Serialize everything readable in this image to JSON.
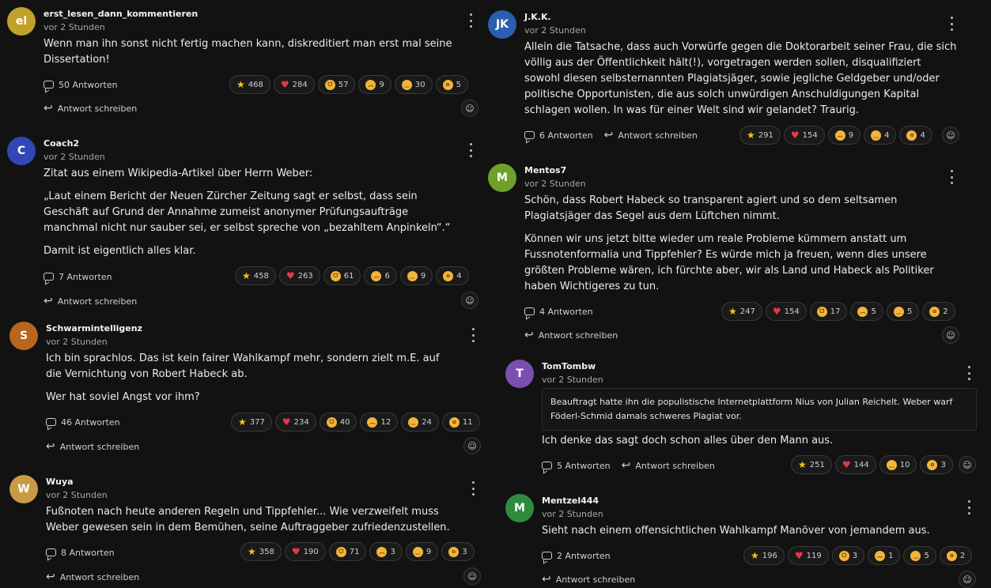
{
  "left": [
    {
      "initials": "el",
      "color": "#c2a12b",
      "author": "erst_lesen_dann_kommentieren",
      "time": "vor 2 Stunden",
      "paragraphs": [
        "Wenn man ihn sonst nicht fertig machen kann, diskreditiert man erst mal seine Dissertation!"
      ],
      "replies": "50 Antworten",
      "reply_label": "Antwort schreiben",
      "reactions": {
        "star": "468",
        "heart": "284",
        "grin": "57",
        "sad": "9",
        "smile": "30",
        "wow": "5"
      }
    },
    {
      "initials": "C",
      "color": "#3346b8",
      "author": "Coach2",
      "time": "vor 2 Stunden",
      "paragraphs": [
        "Zitat aus einem Wikipedia-Artikel über Herrn Weber:",
        "„Laut einem Bericht der Neuen Zürcher Zeitung sagt er selbst, dass sein Geschäft auf Grund der Annahme zumeist anonymer Prüfungsaufträge manchmal nicht nur sauber sei, er selbst spreche von „bezahltem Anpinkeln“.“",
        "Damit ist eigentlich alles klar."
      ],
      "replies": "7 Antworten",
      "reply_label": "Antwort schreiben",
      "reactions": {
        "star": "458",
        "heart": "263",
        "grin": "61",
        "sad": "6",
        "smile": "9",
        "wow": "4"
      }
    },
    {
      "initials": "S",
      "color": "#b8651f",
      "author": "Schwarmintelligenz",
      "time": "vor 2 Stunden",
      "paragraphs": [
        "Ich bin sprachlos. Das ist kein fairer Wahlkampf mehr, sondern zielt m.E. auf die Vernichtung von Robert Habeck ab.",
        "Wer hat soviel Angst vor ihm?"
      ],
      "replies": "46 Antworten",
      "reply_label": "Antwort schreiben",
      "reactions": {
        "star": "377",
        "heart": "234",
        "grin": "40",
        "sad": "12",
        "smile": "24",
        "wow": "11"
      }
    },
    {
      "initials": "W",
      "color": "#c99a45",
      "author": "Wuya",
      "time": "vor 2 Stunden",
      "paragraphs": [
        "Fußnoten nach heute anderen Regeln und Tippfehler... Wie verzweifelt muss Weber gewesen sein in dem Bemühen, seine Auftraggeber zufriedenzustellen."
      ],
      "replies": "8 Antworten",
      "reply_label": "Antwort schreiben",
      "reactions": {
        "star": "358",
        "heart": "190",
        "grin": "71",
        "sad": "3",
        "smile": "9",
        "wow": "3"
      }
    }
  ],
  "right": [
    {
      "initials": "JK",
      "color": "#2a5fb0",
      "author": "J.K.K.",
      "time": "vor 2 Stunden",
      "paragraphs": [
        "Allein die Tatsache, dass auch Vorwürfe gegen die Doktorarbeit seiner Frau, die sich völlig aus der Öffentlichkeit hält(!), vorgetragen werden sollen, disqualifiziert sowohl diesen selbsternannten Plagiatsjäger, sowie jegliche Geldgeber und/oder politische Opportunisten, die aus solch unwürdigen Anschuldigungen Kapital schlagen wollen. In was für einer Welt sind wir gelandet? Traurig."
      ],
      "replies": "6 Antworten",
      "reply_label": "Antwort schreiben",
      "reactions": {
        "star": "291",
        "heart": "154",
        "sad": "9",
        "smile": "4",
        "wow": "4"
      }
    },
    {
      "initials": "M",
      "color": "#6fa12a",
      "author": "Mentos7",
      "time": "vor 2 Stunden",
      "paragraphs": [
        "Schön, dass Robert Habeck so transparent agiert und so dem seltsamen Plagiatsjäger das Segel aus dem Lüftchen nimmt.",
        "Können wir uns jetzt bitte wieder um reale Probleme kümmern anstatt um Fussnotenformalia und Tippfehler? Es würde mich ja freuen, wenn dies unsere größten Probleme wären, ich fürchte aber, wir als Land und Habeck als Politiker haben Wichtigeres zu tun."
      ],
      "replies": "4 Antworten",
      "reply_label": "Antwort schreiben",
      "reactions": {
        "star": "247",
        "heart": "154",
        "grin": "17",
        "sad": "5",
        "smile": "5",
        "wow": "2"
      }
    },
    {
      "initials": "T",
      "color": "#7b4fb0",
      "author": "TomTombw",
      "time": "vor 2 Stunden",
      "quote": "Beauftragt hatte ihn die populistische Internetplattform Nius von Julian Reichelt. Weber warf Föderl-Schmid damals schweres Plagiat vor.",
      "paragraphs": [
        "Ich denke das sagt doch schon alles über den Mann aus."
      ],
      "replies": "5 Antworten",
      "reply_label": "Antwort schreiben",
      "reactions": {
        "star": "251",
        "heart": "144",
        "smile": "10",
        "wow": "3"
      }
    },
    {
      "initials": "M",
      "color": "#2e8b3e",
      "author": "Mentzel444",
      "time": "vor 2 Stunden",
      "paragraphs": [
        "Sieht nach einem offensichtlichen Wahlkampf Manöver von jemandem aus."
      ],
      "replies": "2 Antworten",
      "reply_label": "Antwort schreiben",
      "reactions": {
        "star": "196",
        "heart": "119",
        "grin": "3",
        "sad": "1",
        "smile": "5",
        "wow": "2"
      }
    }
  ]
}
